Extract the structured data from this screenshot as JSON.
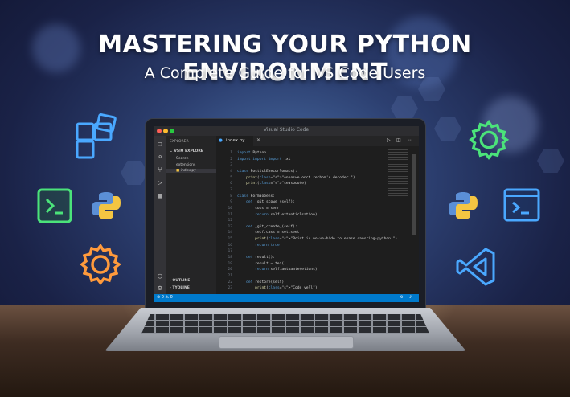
{
  "headline": {
    "title": "MASTERING YOUR PYTHON ENVIRONMENT",
    "subtitle": "A Complete Guide for VS Code Users"
  },
  "window": {
    "title": "Visual Studio Code"
  },
  "sidebar": {
    "header": "EXPLORER",
    "folder": "VSIU EXPLORE",
    "items": [
      "Search",
      "extensions",
      "index.py"
    ],
    "outline": "OUTLINE",
    "timeline": "TYOLINE"
  },
  "editor": {
    "tab_label": "index.py",
    "line_numbers": [
      "1",
      "2",
      "3",
      "4",
      "5",
      "6",
      "7",
      "8",
      "9",
      "10",
      "11",
      "12",
      "13",
      "14",
      "15",
      "16",
      "17",
      "18",
      "19",
      "20",
      "21",
      "22",
      "23"
    ],
    "lines": [
      "import Python",
      "import import import txt",
      "",
      "class PosticlExecorlonals):",
      "    print(\"Annoswe onct retbom's decoder.\")",
      "    print(\"seasooote)",
      "",
      "class Formaobens:",
      "    def _git_scowe_(self):",
      "        soss = senr",
      "        return self.extenticlsation)",
      "",
      "    def _git_create_(self):",
      "        self.cass = set.seet",
      "        print(\"Point is no-ve-hide to enase cansring-python.\")",
      "        return true",
      "",
      "    def result():",
      "        result = tez()",
      "        return self.autoaate(etions)",
      "",
      "    def restore(self):",
      "        print(\"Code vell\")"
    ]
  },
  "status": {
    "left": "⊗ 0 ⚠ 0"
  },
  "colors": {
    "accent": "#007acc",
    "editor_bg": "#1e1e1e",
    "icon_blue": "#4aa8ff",
    "icon_green": "#4be37a",
    "icon_orange": "#ff9a3c"
  }
}
